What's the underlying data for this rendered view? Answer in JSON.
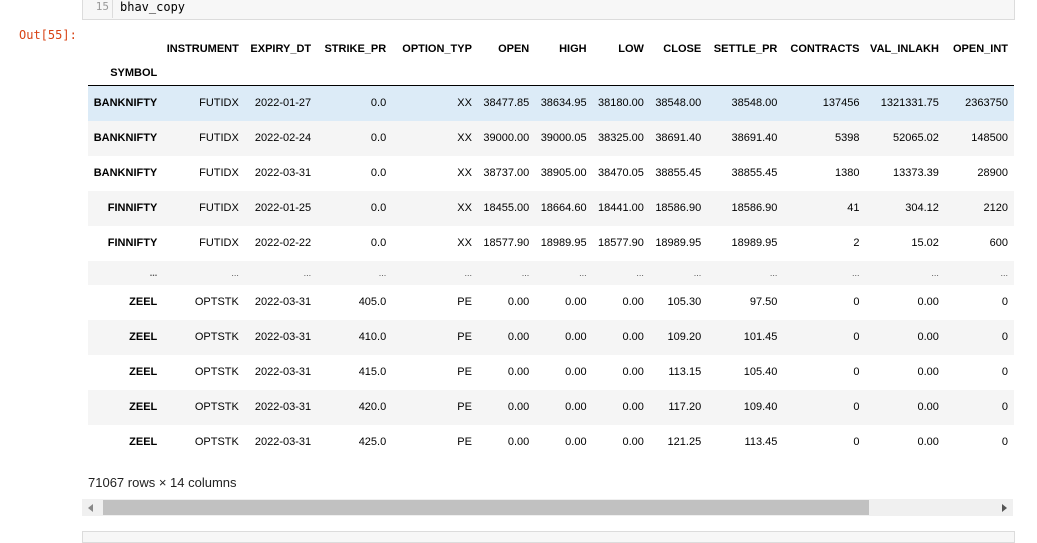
{
  "input_cell": {
    "line_number": "15",
    "code": "bhav_copy"
  },
  "output_prompt": "Out[55]:",
  "table": {
    "index_name": "SYMBOL",
    "columns": [
      "INSTRUMENT",
      "EXPIRY_DT",
      "STRIKE_PR",
      "OPTION_TYP",
      "OPEN",
      "HIGH",
      "LOW",
      "CLOSE",
      "SETTLE_PR",
      "CONTRACTS",
      "VAL_INLAKH",
      "OPEN_INT"
    ],
    "rows": [
      {
        "symbol": "BANKNIFTY",
        "cells": [
          "FUTIDX",
          "2022-01-27",
          "0.0",
          "XX",
          "38477.85",
          "38634.95",
          "38180.00",
          "38548.00",
          "38548.00",
          "137456",
          "1321331.75",
          "2363750"
        ]
      },
      {
        "symbol": "BANKNIFTY",
        "cells": [
          "FUTIDX",
          "2022-02-24",
          "0.0",
          "XX",
          "39000.00",
          "39000.05",
          "38325.00",
          "38691.40",
          "38691.40",
          "5398",
          "52065.02",
          "148500"
        ]
      },
      {
        "symbol": "BANKNIFTY",
        "cells": [
          "FUTIDX",
          "2022-03-31",
          "0.0",
          "XX",
          "38737.00",
          "38905.00",
          "38470.05",
          "38855.45",
          "38855.45",
          "1380",
          "13373.39",
          "28900"
        ]
      },
      {
        "symbol": "FINNIFTY",
        "cells": [
          "FUTIDX",
          "2022-01-25",
          "0.0",
          "XX",
          "18455.00",
          "18664.60",
          "18441.00",
          "18586.90",
          "18586.90",
          "41",
          "304.12",
          "2120"
        ]
      },
      {
        "symbol": "FINNIFTY",
        "cells": [
          "FUTIDX",
          "2022-02-22",
          "0.0",
          "XX",
          "18577.90",
          "18989.95",
          "18577.90",
          "18989.95",
          "18989.95",
          "2",
          "15.02",
          "600"
        ]
      },
      {
        "symbol": "...",
        "cells": [
          "...",
          "...",
          "...",
          "...",
          "...",
          "...",
          "...",
          "...",
          "...",
          "...",
          "...",
          "..."
        ]
      },
      {
        "symbol": "ZEEL",
        "cells": [
          "OPTSTK",
          "2022-03-31",
          "405.0",
          "PE",
          "0.00",
          "0.00",
          "0.00",
          "105.30",
          "97.50",
          "0",
          "0.00",
          "0"
        ]
      },
      {
        "symbol": "ZEEL",
        "cells": [
          "OPTSTK",
          "2022-03-31",
          "410.0",
          "PE",
          "0.00",
          "0.00",
          "0.00",
          "109.20",
          "101.45",
          "0",
          "0.00",
          "0"
        ]
      },
      {
        "symbol": "ZEEL",
        "cells": [
          "OPTSTK",
          "2022-03-31",
          "415.0",
          "PE",
          "0.00",
          "0.00",
          "0.00",
          "113.15",
          "105.40",
          "0",
          "0.00",
          "0"
        ]
      },
      {
        "symbol": "ZEEL",
        "cells": [
          "OPTSTK",
          "2022-03-31",
          "420.0",
          "PE",
          "0.00",
          "0.00",
          "0.00",
          "117.20",
          "109.40",
          "0",
          "0.00",
          "0"
        ]
      },
      {
        "symbol": "ZEEL",
        "cells": [
          "OPTSTK",
          "2022-03-31",
          "425.0",
          "PE",
          "0.00",
          "0.00",
          "0.00",
          "121.25",
          "113.45",
          "0",
          "0.00",
          "0"
        ]
      }
    ],
    "selected_row": 0,
    "summary": "71067 rows × 14 columns"
  },
  "colors": {
    "selected_row_bg": "#dcebf7",
    "striped_row_bg": "#f5f5f5",
    "prompt_color": "#d84315"
  }
}
